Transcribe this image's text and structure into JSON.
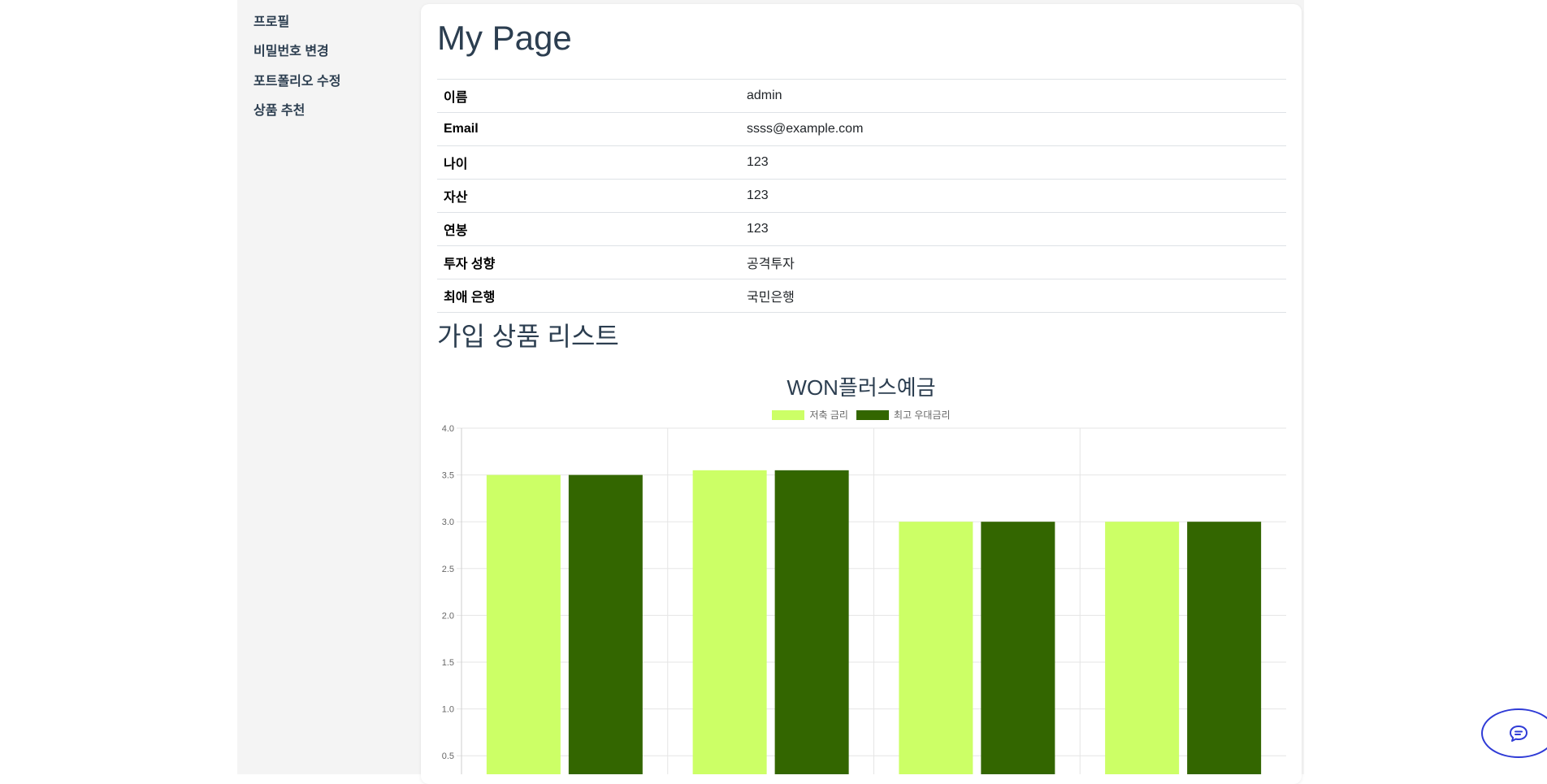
{
  "sidebar": {
    "items": [
      {
        "label": "프로필"
      },
      {
        "label": "비밀번호 변경"
      },
      {
        "label": "포트폴리오 수정"
      },
      {
        "label": "상품 추천"
      }
    ]
  },
  "main": {
    "title": "My Page",
    "profile_rows": [
      {
        "label": "이름",
        "value": "admin"
      },
      {
        "label": "Email",
        "value": "ssss@example.com"
      },
      {
        "label": "나이",
        "value": "123"
      },
      {
        "label": "자산",
        "value": "123"
      },
      {
        "label": "연봉",
        "value": "123"
      },
      {
        "label": "투자 성향",
        "value": "공격투자"
      },
      {
        "label": "최애 은행",
        "value": "국민은행"
      }
    ],
    "section_title": "가입 상품 리스트"
  },
  "chart_data": {
    "type": "bar",
    "title": "WON플러스예금",
    "categories": [
      "",
      "",
      "",
      ""
    ],
    "series": [
      {
        "name": "저축 금리",
        "values": [
          3.5,
          3.55,
          3.0,
          3.0
        ],
        "color": "#ccff66"
      },
      {
        "name": "최고 우대금리",
        "values": [
          3.5,
          3.55,
          3.0,
          3.0
        ],
        "color": "#336600"
      }
    ],
    "ylim": [
      0,
      4.0
    ],
    "yticks": [
      "0.5",
      "1.0",
      "1.5",
      "2.0",
      "2.5",
      "3.0",
      "3.5",
      "4.0"
    ],
    "grid": true,
    "legend": "top"
  },
  "colors": {
    "heading": "#2c3e50",
    "sidebar_bg": "#f4f4f4",
    "chat_border": "#2f3bd6"
  },
  "icons": {
    "chat": "chat-bubble-icon"
  }
}
